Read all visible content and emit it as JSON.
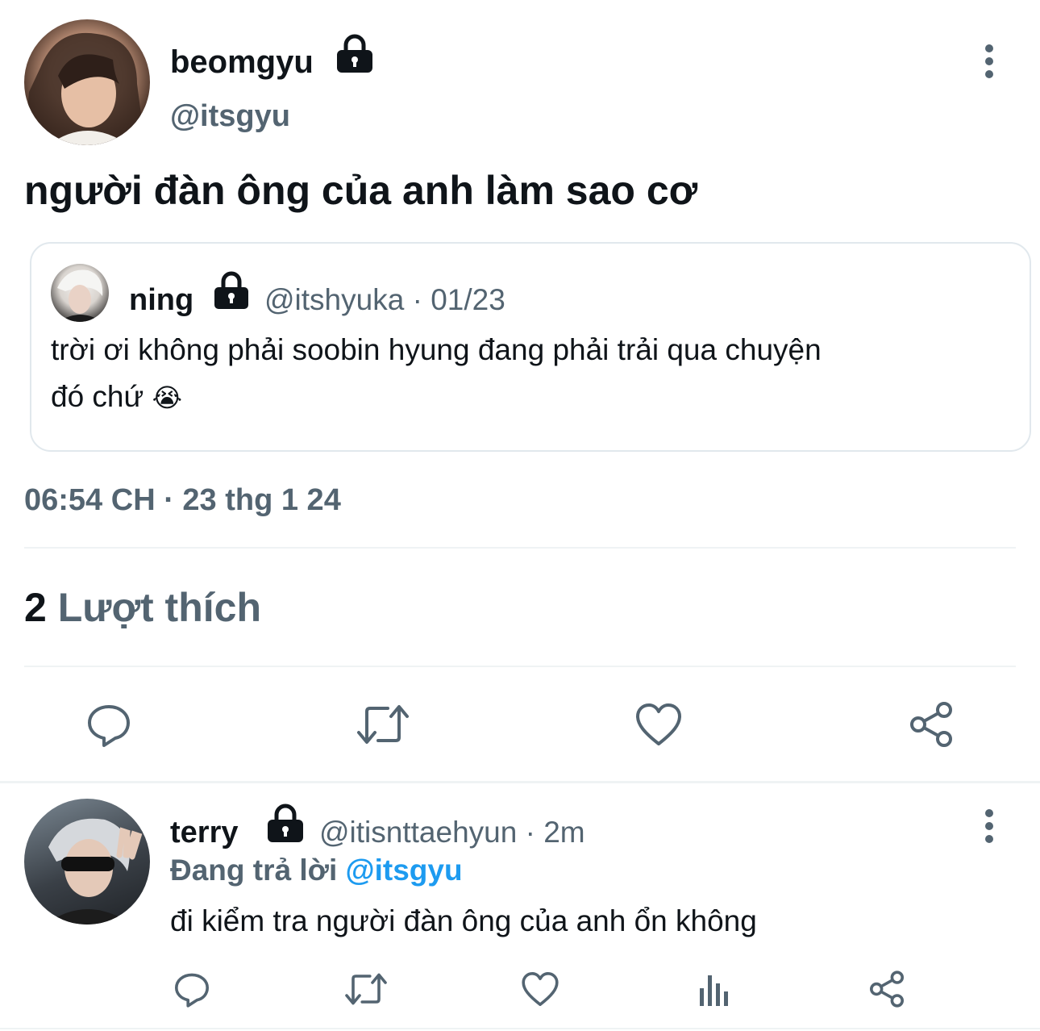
{
  "tweet": {
    "author": {
      "display_name": "beomgyu",
      "handle": "@itsgyu",
      "avatar": "avatar"
    },
    "text": "người đàn ông của anh làm sao cơ",
    "quote": {
      "display_name": "ning",
      "handle": "@itshyuka",
      "separator": "·",
      "date": "01/23",
      "text_line1": "trời ơi không phải soobin hyung đang phải trải qua chuyện",
      "text_line2": "đó chứ",
      "emoji": "😭"
    },
    "timestamp": "06:54 CH · 23 thg 1 24",
    "likes_count": "2",
    "likes_label": "Lượt thích",
    "actions": [
      "reply-icon",
      "retweet-icon",
      "like-icon",
      "share-icon"
    ]
  },
  "reply": {
    "display_name": "terry",
    "handle": "@itisnttaehyun",
    "separator": "·",
    "time": "2m",
    "replying_prefix": "Đang trả lời",
    "replying_to": "@itsgyu",
    "text": "đi kiểm tra người đàn ông của anh ổn không",
    "actions": [
      "reply-icon",
      "retweet-icon",
      "like-icon",
      "analytics-icon",
      "share-icon"
    ]
  },
  "colors": {
    "text": "#0f1419",
    "secondary": "#536471",
    "accent": "#1d9bf0",
    "divider": "#eff3f4"
  }
}
